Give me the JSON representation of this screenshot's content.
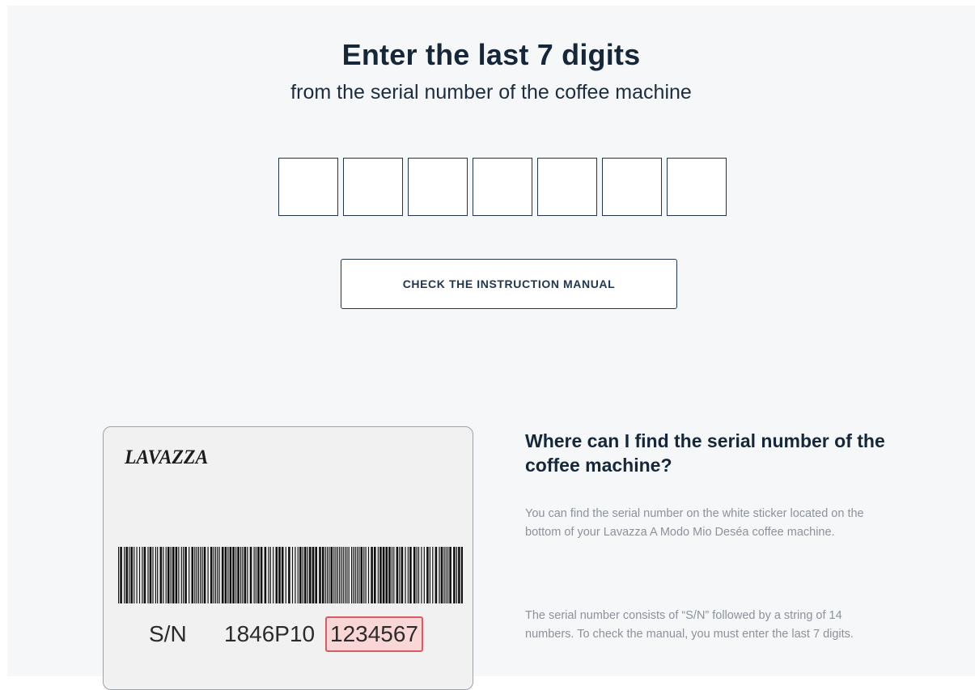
{
  "heading": {
    "title": "Enter the last 7 digits",
    "subtitle": "from the serial number of the coffee machine"
  },
  "digit_inputs": [
    "",
    "",
    "",
    "",
    "",
    "",
    ""
  ],
  "manual_button": {
    "label": "CHECK THE INSTRUCTION MANUAL"
  },
  "sticker": {
    "brand_logo": "LAVAZZA",
    "sn_label": "S/N",
    "sn_prefix": "1846P10",
    "sn_last_digits": "1234567",
    "highlight_color": "#d65c63"
  },
  "help": {
    "title": "Where can I find the serial number of the coffee machine?",
    "paragraph_1": "You can find the serial number on the white sticker located on the bottom of your Lavazza A Modo Mio Deséa coffee machine.",
    "paragraph_2": "The serial number consists of “S/N” followed by a string of 14 numbers. To check the manual, you must enter the last 7 digits."
  },
  "colors": {
    "background": "#f6f7f9",
    "primary_dark": "#16273a",
    "border": "#1f3550",
    "muted_text": "#8b929b"
  }
}
